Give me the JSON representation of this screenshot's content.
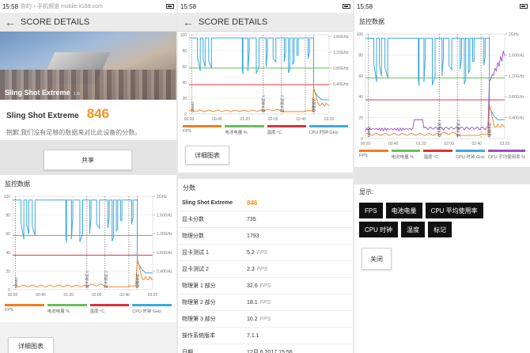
{
  "status_left": {
    "time": "15:58",
    "watermark": "你的・手机频道 mobile.it168.com"
  },
  "status_mid": {
    "time": "15:58"
  },
  "status_right": {
    "time": "15:58"
  },
  "header": {
    "title": "SCORE DETAILS"
  },
  "hero": {
    "title": "Sling Shot Extreme",
    "version": "1.6"
  },
  "score": {
    "name": "Sling Shot Extreme",
    "value": "846",
    "note": "抱歉,我们没有足够的数据来对比此设备的分数。"
  },
  "share_label": "共享",
  "monitor_label": "监控数据",
  "detail_chart_label": "详细图表",
  "legend": [
    {
      "label": "FPS",
      "color": "#f07e22"
    },
    {
      "label": "电池电量 %",
      "color": "#64c15a"
    },
    {
      "label": "温度 °C",
      "color": "#d9343a"
    },
    {
      "label": "CPU 时钟 GHz",
      "color": "#3da9e0"
    }
  ],
  "legend3": [
    {
      "label": "FPS",
      "color": "#f07e22"
    },
    {
      "label": "电池电量 %",
      "color": "#64c15a"
    },
    {
      "label": "温度 °C",
      "color": "#d9343a"
    },
    {
      "label": "CPU 时钟 GHz",
      "color": "#3da9e0"
    },
    {
      "label": "CPU 平均使用率 %",
      "color": "#9a4fc2"
    }
  ],
  "axis": {
    "y_left": [
      "100",
      "80",
      "60",
      "40",
      "20",
      "0"
    ],
    "y_right": [
      "2GHz",
      "1.60GHz",
      "1.20GHz",
      "0.80GHz",
      "0.40GHz"
    ],
    "y_right_mid": [
      "1.60GHz",
      "1.20GHz",
      "0.80GHz",
      "0.40GHz"
    ],
    "x": [
      "00:00",
      "00:40",
      "01:20",
      "02:00",
      "02:40",
      "03:20"
    ],
    "markers": [
      "DEMO",
      "显卡测试 1",
      "显卡测试 2",
      "物理测试"
    ]
  },
  "scores_label": "分数",
  "table": [
    {
      "k": "Sling Shot Extreme",
      "v": "846",
      "u": "",
      "main": true
    },
    {
      "k": "显卡分数",
      "v": "735",
      "u": ""
    },
    {
      "k": "物理分数",
      "v": "1793",
      "u": ""
    },
    {
      "k": "显卡测试 1",
      "v": "5.2",
      "u": "FPS"
    },
    {
      "k": "显卡测试 2",
      "v": "2.3",
      "u": "FPS"
    },
    {
      "k": "物理第 1 部分",
      "v": "32.6",
      "u": "FPS"
    },
    {
      "k": "物理第 2 部分",
      "v": "18.1",
      "u": "FPS"
    },
    {
      "k": "物理第 3 部分",
      "v": "10.2",
      "u": "FPS"
    },
    {
      "k": "操作系统版本",
      "v": "7.1.1",
      "u": ""
    },
    {
      "k": "日期",
      "v": "12月 6 2017 15:56",
      "u": ""
    }
  ],
  "display_label": "显示:",
  "chips": [
    "FPS",
    "电池电量",
    "CPU 平均使用率",
    "CPU 时钟",
    "温度",
    "标记"
  ],
  "close_label": "关闭"
}
